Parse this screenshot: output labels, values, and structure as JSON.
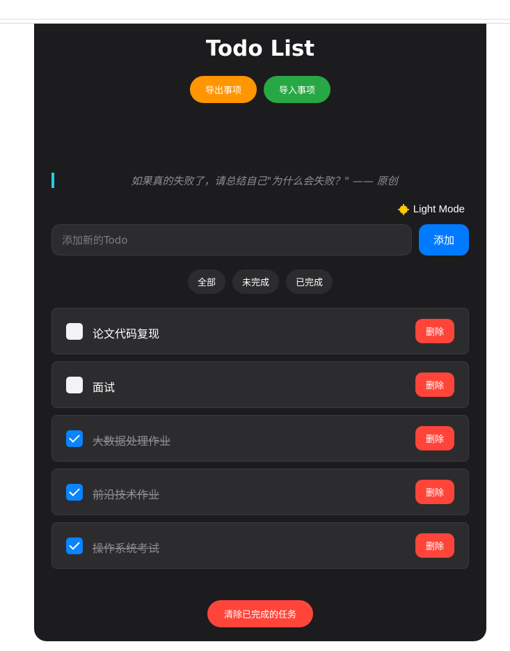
{
  "app": {
    "title": "Todo List",
    "export_label": "导出事项",
    "import_label": "导入事项",
    "quote": "如果真的失败了，请总结自己\"为什么会失败？\" —— 原创",
    "mode_label": "Light Mode",
    "mode_icon": "sun-icon"
  },
  "add": {
    "placeholder": "添加新的Todo",
    "value": "",
    "button_label": "添加"
  },
  "filters": [
    "全部",
    "未完成",
    "已完成"
  ],
  "todos": [
    {
      "text": "论文代码复现",
      "done": false,
      "delete_label": "删除"
    },
    {
      "text": "面试",
      "done": false,
      "delete_label": "删除"
    },
    {
      "text": "大数据处理作业",
      "done": true,
      "delete_label": "删除"
    },
    {
      "text": "前沿技术作业",
      "done": true,
      "delete_label": "删除"
    },
    {
      "text": "操作系统考试",
      "done": true,
      "delete_label": "删除"
    }
  ],
  "clear_label": "清除已完成的任务",
  "colors": {
    "accent": "#007aff",
    "export": "#ff9500",
    "import": "#28a745",
    "danger": "#ff453a",
    "panel": "#1c1c1e",
    "quote_bar": "#1fd1e0"
  }
}
